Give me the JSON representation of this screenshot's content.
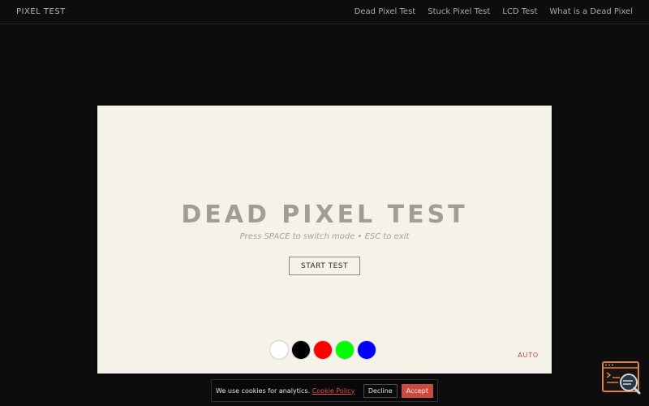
{
  "header": {
    "brand": "PIXEL TEST",
    "nav": [
      {
        "label": "Dead Pixel Test"
      },
      {
        "label": "Stuck Pixel Test"
      },
      {
        "label": "LCD Test"
      },
      {
        "label": "What is a Dead Pixel"
      }
    ]
  },
  "panel": {
    "title": "DEAD PIXEL TEST",
    "hint": "Press SPACE to switch mode • ESC to exit",
    "start_label": "START TEST",
    "auto_label": "AUTO",
    "background_color": "#f5f2e9",
    "swatches": [
      {
        "name": "white",
        "color": "#ffffff"
      },
      {
        "name": "black",
        "color": "#000000"
      },
      {
        "name": "red",
        "color": "#ff0000"
      },
      {
        "name": "green",
        "color": "#00ff00"
      },
      {
        "name": "blue",
        "color": "#0000ff"
      }
    ]
  },
  "cookie": {
    "text": "We use cookies for analytics.",
    "policy_link": "Cookie Policy",
    "decline_label": "Decline",
    "accept_label": "Accept"
  },
  "widget": {
    "icon": "terminal-search-icon",
    "accent_color": "#d9824e"
  }
}
